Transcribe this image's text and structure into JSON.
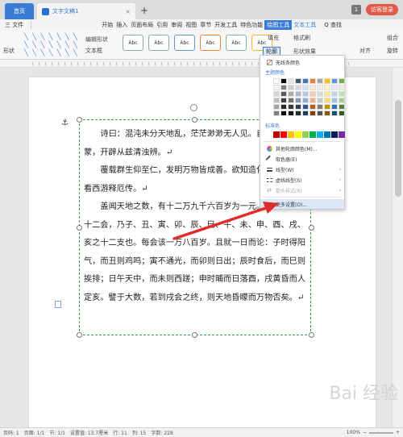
{
  "titlebar": {
    "home_tab": "首页",
    "doc_tab": "文字文稿1",
    "tab_close": "×",
    "new_tab": "+",
    "page_badge": "1",
    "visitor_button": "访客登录"
  },
  "menubar": {
    "file": "三 文件",
    "items": [
      "开始",
      "插入",
      "页面布局",
      "引用",
      "审阅",
      "视图",
      "章节",
      "开发工具",
      "特色功能",
      "绘图工具",
      "文本工具"
    ],
    "active_index": 9,
    "find": "Q 查找"
  },
  "ribbon": {
    "shape_label": "形状",
    "edit_shape": "编辑形状",
    "text_box": "文本框",
    "abc_labels": [
      "Abc",
      "Abc",
      "Abc",
      "Abc",
      "Abc",
      "Abc"
    ],
    "fill": "填充",
    "format_brush": "格式刷",
    "outline": "轮廓",
    "shape_effect": "形状效果",
    "group": "组合",
    "rotate": "旋转",
    "align": "对齐"
  },
  "document": {
    "paragraphs": [
      "诗曰：混沌未分天地乱，茫茫渺渺无人见。自从盘古破鸿蒙，开辟从兹清浊辨。↵",
      "覆载群生仰至仁，发明万物皆成善。欲知造化会元功，须看西游释厄传。↵",
      "盖闻天地之数，有十二万九千六百岁为一元。将一元分为十二会，乃子、丑、寅、卯、辰、巳、午、未、申、酉、戌、亥之十二支也。每会该一万八百岁。且就一日而论：子时得阳气，而丑则鸡鸣；寅不通光，而卯则日出；辰时食后，而巳则挨排；日午天中，而未则西蹉；申时晡而日落酉，戌黄昏而人定亥。譬于大数，若到戌会之终，则天地昏矇而万物否矣。↵"
    ]
  },
  "dropdown": {
    "no_line_color": "无线条颜色",
    "theme_colors": "主题颜色",
    "standard_colors": "标准色",
    "other_colors": "其他轮廓颜色(M)...",
    "eyedropper": "取色器(E)",
    "line_style": "线型(W)",
    "dash_style": "虚线线型(S)",
    "arrow_style": "箭头样式(R)",
    "more_settings": "更多设置(O)...",
    "theme_palette": [
      [
        "#ffffff",
        "#000000",
        "#e7e6e6",
        "#44546a",
        "#4472c4",
        "#ed7d31",
        "#a5a5a5",
        "#ffc000",
        "#5b9bd5",
        "#70ad47"
      ],
      [
        "#f2f2f2",
        "#808080",
        "#d0cece",
        "#d6dce4",
        "#d9e2f3",
        "#fbe5d5",
        "#ededed",
        "#fff2cc",
        "#deebf6",
        "#e2efd9"
      ],
      [
        "#d8d8d8",
        "#595959",
        "#aeabab",
        "#adb9ca",
        "#b4c6e7",
        "#f7caac",
        "#dbdbdb",
        "#fee599",
        "#bdd7ee",
        "#c5e0b3"
      ],
      [
        "#bfbfbf",
        "#3f3f3f",
        "#757070",
        "#8496b0",
        "#8eaadb",
        "#f4b183",
        "#c9c9c9",
        "#ffd965",
        "#9cc3e5",
        "#a8d08d"
      ],
      [
        "#a5a5a5",
        "#262626",
        "#3a3838",
        "#323f4f",
        "#2f5496",
        "#c55a11",
        "#7b7b7b",
        "#bf9000",
        "#2e75b5",
        "#538135"
      ],
      [
        "#7f7f7f",
        "#0c0c0c",
        "#171616",
        "#222a35",
        "#1f3864",
        "#833c0b",
        "#525252",
        "#7f6000",
        "#1e4e79",
        "#375623"
      ]
    ],
    "standard_palette": [
      "#c00000",
      "#ff0000",
      "#ffc000",
      "#ffff00",
      "#92d050",
      "#00b050",
      "#00b0f0",
      "#0070c0",
      "#002060",
      "#7030a0"
    ]
  },
  "statusbar": {
    "page_count": "页码: 1",
    "page": "页面: 1/1",
    "section": "节: 1/1",
    "setting": "设置值: 13.7厘米",
    "row": "行: 11",
    "col": "列: 15",
    "words": "字数: 228",
    "zoom": "100%"
  },
  "watermark": "Bai 经验"
}
